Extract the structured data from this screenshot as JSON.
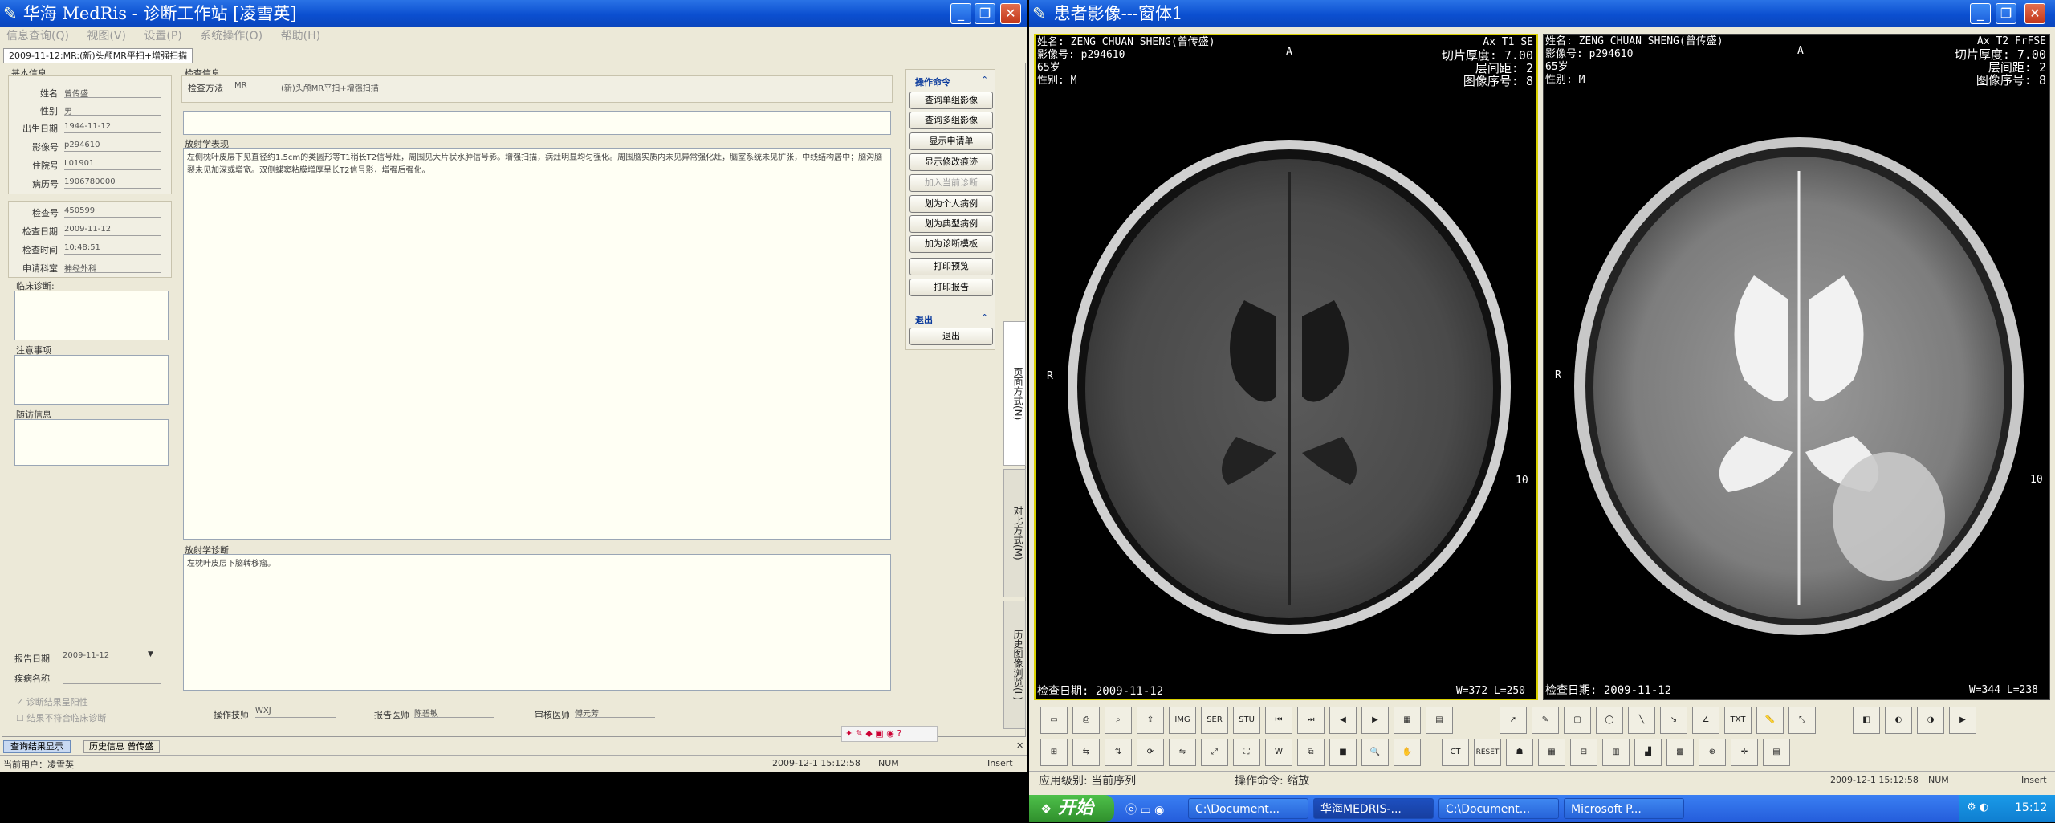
{
  "left_window": {
    "title": "华海 MedRis - 诊断工作站 [凌雪英]",
    "menu": [
      "信息查询(Q)",
      "视图(V)",
      "设置(P)",
      "系统操作(O)",
      "帮助(H)"
    ],
    "tab": "2009-11-12:MR:(新)头颅MR平扫+增强扫描",
    "basic_info": {
      "header": "基本信息",
      "fields": [
        {
          "label": "姓名",
          "value": "曾传盛"
        },
        {
          "label": "性别",
          "value": "男"
        },
        {
          "label": "出生日期",
          "value": "1944-11-12"
        },
        {
          "label": "影像号",
          "value": "p294610"
        },
        {
          "label": "住院号",
          "value": "L01901"
        },
        {
          "label": "病历号",
          "value": "1906780000"
        }
      ],
      "fields2": [
        {
          "label": "检查号",
          "value": "450599"
        },
        {
          "label": "检查日期",
          "value": "2009-11-12"
        },
        {
          "label": "检查时间",
          "value": "10:48:51"
        },
        {
          "label": "申请科室",
          "value": "神经外科"
        }
      ],
      "clinical_label": "临床诊断:",
      "notes_label": "注意事项",
      "followup_label": "随访信息",
      "report_date_label": "报告日期",
      "report_date_value": "2009-11-12",
      "disease_label": "疾病名称",
      "chk1": "诊断结果呈阳性",
      "chk2": "结果不符合临床诊断"
    },
    "exam": {
      "header": "检查信息",
      "method_label": "检查方法",
      "modality": "MR",
      "method_value": "(新)头颅MR平扫+增强扫描",
      "findings_label": "放射学表现",
      "findings_text": "左侧枕叶皮层下见直径约1.5cm的类圆形等T1稍长T2信号灶，周围见大片状水肿信号影。增强扫描，病灶明显均匀强化。周围脑实质内未见异常强化灶，脑室系统未见扩张，中线结构居中；脑沟脑裂未见加深或增宽。双侧蝶窦粘膜增厚呈长T2信号影，增强后强化。",
      "diagnosis_label": "放射学诊断",
      "diagnosis_text": "左枕叶皮层下脑转移瘤。",
      "operator_label": "操作技师",
      "operator_value": "WXJ",
      "reporter_label": "报告医师",
      "reporter_value": "陈碧敏",
      "reviewer_label": "审核医师",
      "reviewer_value": "傅元芳"
    },
    "commands": {
      "header": "操作命令",
      "buttons": [
        "查询单组影像",
        "查询多组影像",
        "显示申请单",
        "显示修改痕迹",
        "加入当前诊断",
        "划为个人病例",
        "划为典型病例",
        "加为诊断模板",
        "打印预览",
        "打印报告"
      ],
      "exit_header": "退出",
      "exit_button": "退出"
    },
    "side_tabs": [
      "页面方式(N)",
      "对比方式(M)",
      "历史图像浏览(L)"
    ],
    "bottom_tabs": [
      "查询结果显示",
      "历史信息 曾传盛"
    ],
    "status": {
      "user": "当前用户：凌雪英",
      "datetime": "2009-12-1 15:12:58",
      "num": "NUM",
      "ins": "Insert"
    }
  },
  "right_window": {
    "title": "患者影像---窗体1",
    "image1": {
      "name": "姓名: ZENG CHUAN SHENG(曾传盛)",
      "id": "影像号: p294610",
      "age": "65岁",
      "sex": "性别: M",
      "seq": "Ax T1 SE",
      "thick": "切片厚度: 7.00",
      "gap": "层间距: 2",
      "imgno": "图像序号: 8",
      "date": "检查日期: 2009-11-12",
      "wl": "W=372 L=250",
      "orient_a": "A",
      "orient_r": "R",
      "scale": "10"
    },
    "image2": {
      "name": "姓名: ZENG CHUAN SHENG(曾传盛)",
      "id": "影像号: p294610",
      "age": "65岁",
      "sex": "性别: M",
      "seq": "Ax T2 FrFSE",
      "thick": "切片厚度: 7.00",
      "gap": "层间距: 2",
      "imgno": "图像序号: 8",
      "date": "检查日期: 2009-11-12",
      "wl": "W=344 L=238",
      "orient_a": "A",
      "orient_r": "R",
      "scale": "10"
    },
    "toolbar_row1": [
      "IMG",
      "SER",
      "STU"
    ],
    "toolbar_row2": [
      "CT",
      "RESET",
      "TXT"
    ],
    "status": {
      "level": "应用级别: 当前序列",
      "command": "操作命令: 缩放",
      "datetime": "2009-12-1 15:12:58",
      "num": "NUM",
      "ins": "Insert"
    }
  },
  "taskbar": {
    "start": "开始",
    "buttons": [
      "C:\\Document...",
      "华海MEDRIS-...",
      "C:\\Document...",
      "Microsoft P..."
    ],
    "clock": "15:12"
  }
}
